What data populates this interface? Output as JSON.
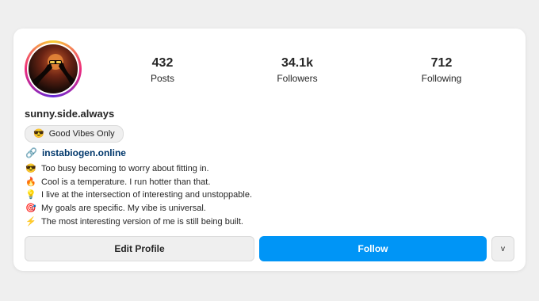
{
  "profile": {
    "username": "sunny.side.always",
    "badge": {
      "icon": "😎",
      "label": "Good Vibes Only"
    },
    "link": {
      "icon": "🔗",
      "text": "instabiogen.online"
    }
  },
  "stats": [
    {
      "value": "432",
      "label": "Posts"
    },
    {
      "value": "34.1k",
      "label": "Followers"
    },
    {
      "value": "712",
      "label": "Following"
    }
  ],
  "bio": [
    {
      "icon": "😎",
      "text": "Too busy becoming to worry about fitting in."
    },
    {
      "icon": "🔥",
      "text": "Cool is a temperature. I run hotter than that."
    },
    {
      "icon": "💡",
      "text": "I live at the intersection of interesting and unstoppable."
    },
    {
      "icon": "🎯",
      "text": "My goals are specific. My vibe is universal."
    },
    {
      "icon": "⚡",
      "text": "The most interesting version of me is still being built."
    }
  ],
  "buttons": {
    "edit": "Edit Profile",
    "follow": "Follow",
    "more": "v"
  },
  "colors": {
    "follow_blue": "#0095f6",
    "link": "#00376b"
  }
}
